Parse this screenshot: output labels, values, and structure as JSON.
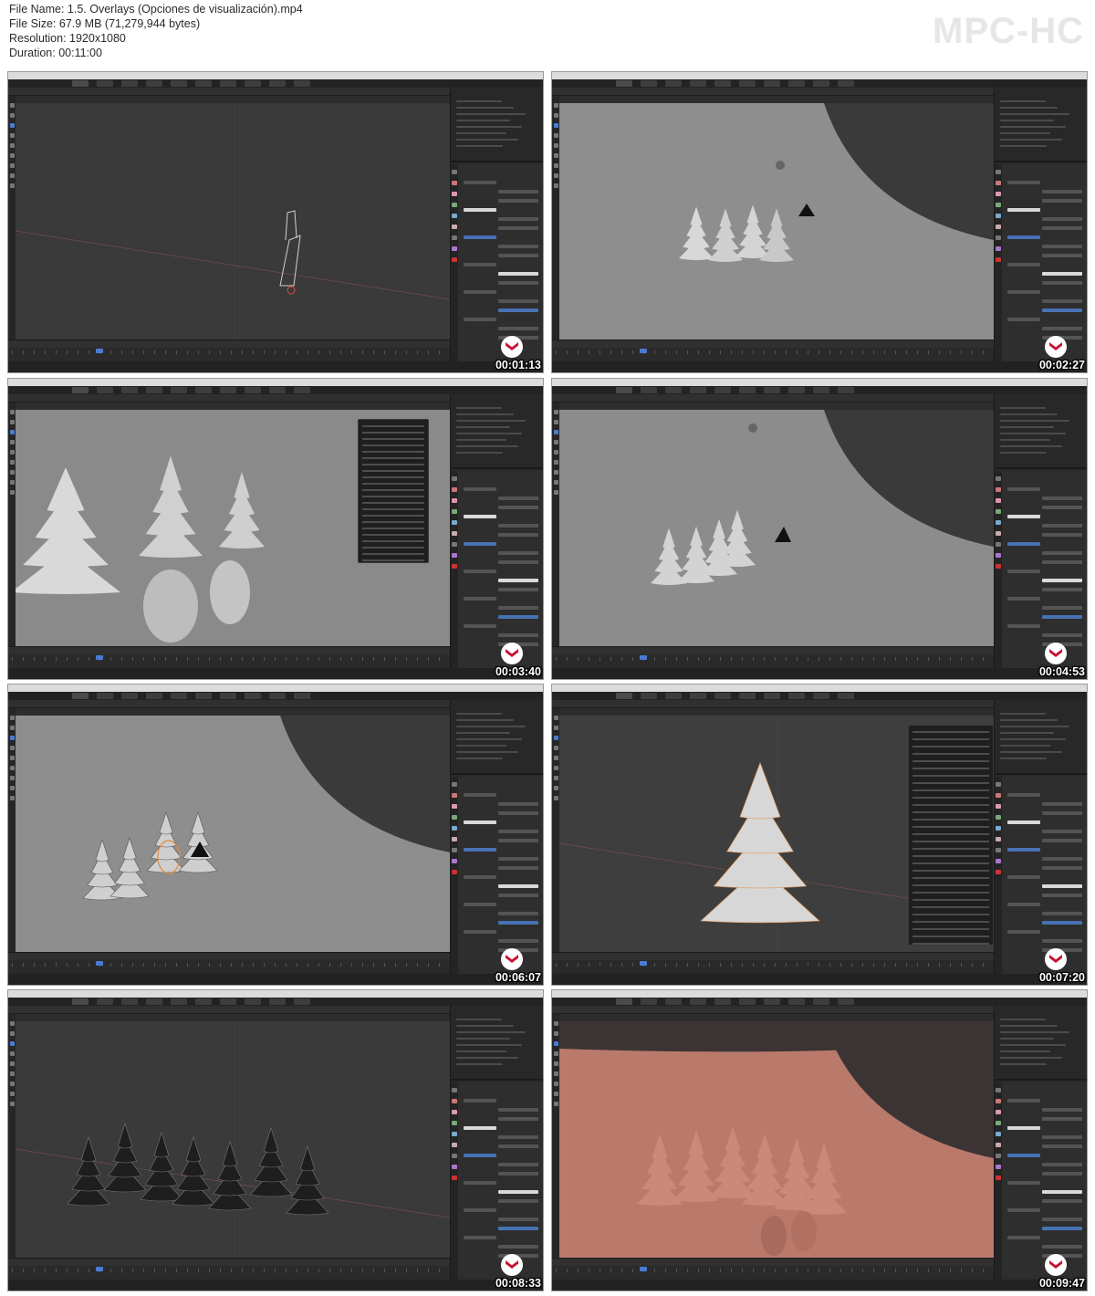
{
  "file_info": {
    "file_name": "File Name: 1.5. Overlays (Opciones de visualización).mp4",
    "file_size": "File Size: 67.9 MB (71,279,944 bytes)",
    "resolution": "Resolution: 1920x1080",
    "duration": "Duration: 00:11:00"
  },
  "brand": "MPC-HC",
  "thumbnails": [
    {
      "timestamp": "00:01:13"
    },
    {
      "timestamp": "00:02:27"
    },
    {
      "timestamp": "00:03:40"
    },
    {
      "timestamp": "00:04:53"
    },
    {
      "timestamp": "00:06:07"
    },
    {
      "timestamp": "00:07:20"
    },
    {
      "timestamp": "00:08:33"
    },
    {
      "timestamp": "00:09:47"
    }
  ],
  "colors": {
    "dark_viewport": "#3a3a3a",
    "grey_viewport": "#8e8e8e",
    "salmon_viewport": "#b97a6c",
    "selection_orange": "#e08a3c",
    "blender_blue": "#4772b3",
    "logo_red": "#c8102e"
  }
}
